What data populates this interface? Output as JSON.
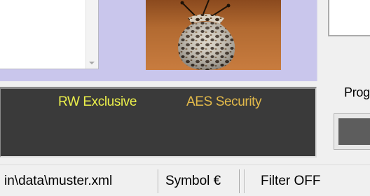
{
  "list": {
    "scroll_icon": "chevron-down-icon"
  },
  "image": {
    "alt": "Leopard print pouch photo"
  },
  "banner": {
    "exclusive_text": "RW Exclusive",
    "security_text": "AES Security",
    "colors": {
      "background": "#3a3a3a",
      "exclusive": "#ecf04b",
      "security": "#e2b94a"
    }
  },
  "progress": {
    "label": "Prog",
    "value": 1.0
  },
  "status_bar": {
    "file_path": "in\\data\\muster.xml",
    "symbol": "Symbol €",
    "filter": "Filter OFF"
  },
  "colors": {
    "panel": "#c9c6ec",
    "window": "#f0f0f0"
  }
}
